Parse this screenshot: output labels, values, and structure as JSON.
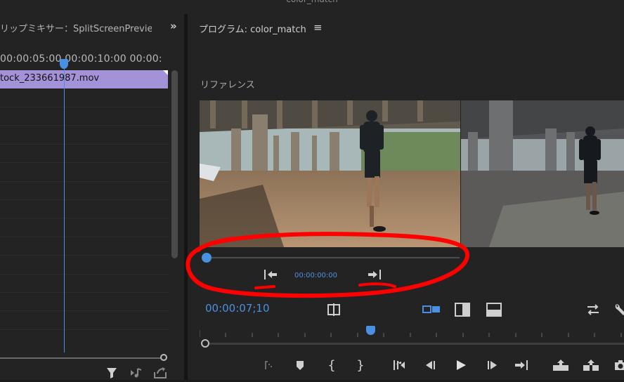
{
  "window": {
    "title": "color_match"
  },
  "left_panel": {
    "title": "リップミキサー：SplitScreenPreview",
    "expand_icon": "double-chevron-right-icon",
    "ruler_text": "00:00:05:00 00:00:10:00 00:00:",
    "clip_label": "tock_233661987.mov",
    "tools": [
      "filter-icon",
      "audio-icon",
      "export-icon"
    ]
  },
  "program": {
    "title": "プログラム: color_match",
    "menu_icon": "hamburger-menu-icon",
    "reference_label": "リファレンス",
    "reference_timecode": "00:00:00:00",
    "timecode": "00:00:07;10",
    "controls": [
      "mark-in-icon",
      "marker-icon",
      "mark-in-brace-icon",
      "mark-out-brace-icon",
      "go-to-in-icon",
      "step-back-icon",
      "play-icon",
      "step-forward-icon",
      "go-to-out-icon",
      "lift-icon",
      "extract-icon",
      "camera-icon"
    ]
  },
  "colors": {
    "accent": "#4a90e2",
    "clip": "#a492d8",
    "annotation": "#ff0000"
  }
}
